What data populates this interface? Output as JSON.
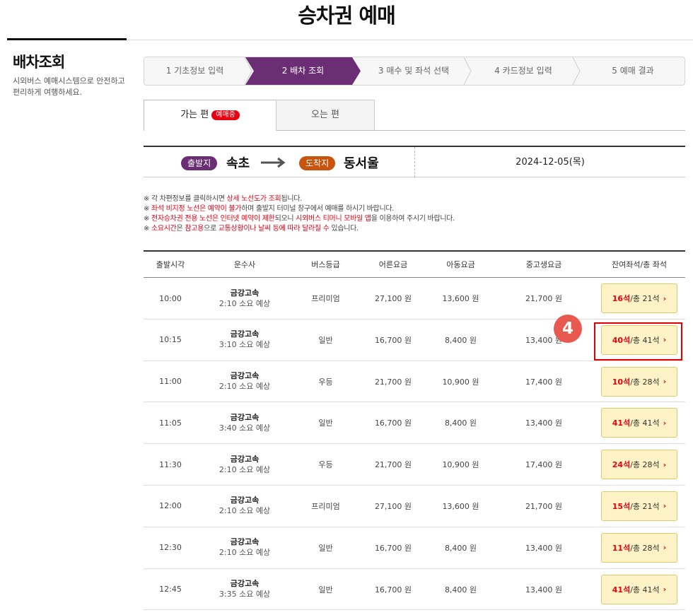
{
  "page": {
    "title": "승차권 예매"
  },
  "sidebar": {
    "title": "배차조회",
    "description": "시외버스 예매시스템으로 안전하고 편리하게 여행하세요."
  },
  "stepper": {
    "steps": [
      {
        "label": "1 기초정보 입력",
        "active": false
      },
      {
        "label": "2 배차 조회",
        "active": true
      },
      {
        "label": "3 매수 및 좌석 선택",
        "active": false
      },
      {
        "label": "4 카드정보 입력",
        "active": false
      },
      {
        "label": "5 예매 결과",
        "active": false
      }
    ],
    "active_color": "#6b2d73"
  },
  "tabs": {
    "go_label": "가는 편",
    "go_badge": "예매중",
    "return_label": "오는 편"
  },
  "route": {
    "departure_label": "출발지",
    "departure": "속초",
    "arrival_label": "도착지",
    "arrival": "동서울",
    "date": "2024-12-05(목)"
  },
  "notices": [
    [
      "※ 각 차편정보를 클릭하시면 ",
      {
        "red": "상세 노선도가 조회"
      },
      "됩니다."
    ],
    [
      "※ ",
      {
        "red": "좌석 비지정 노선은 예약이 불가"
      },
      "하며 출발지 터미널 창구에서 예매를 하시기 바랍니다."
    ],
    [
      "※ ",
      {
        "red": "전자승차권 전용 노선은 인터넷 예약이 제한"
      },
      "되오니 ",
      {
        "red": "시외버스 티머니 모바일 앱"
      },
      "을 이용하여 주시기 바랍니다."
    ],
    [
      "※ ",
      {
        "red": "소요시간"
      },
      "은 ",
      {
        "red": "참고용"
      },
      "으로 ",
      {
        "red": "교통상황이나 날씨 등에 따라 달라질 수"
      },
      " 있습니다."
    ]
  ],
  "table": {
    "headers": [
      "출발시각",
      "운수사",
      "버스등급",
      "어른요금",
      "아동요금",
      "중고생요금",
      "잔여좌석/총 좌석"
    ],
    "rows": [
      {
        "time": "10:00",
        "company": "금강고속",
        "duration": "2:10 소요 예상",
        "grade": "프리미엄",
        "adult": "27,100 원",
        "child": "13,600 원",
        "youth": "21,700 원",
        "remaining": "16석",
        "total": " /총 21석"
      },
      {
        "time": "10:15",
        "company": "금강고속",
        "duration": "3:10 소요 예상",
        "grade": "일반",
        "adult": "16,700 원",
        "child": "8,400 원",
        "youth": "13,400 원",
        "remaining": "40석",
        "total": " /총 41석"
      },
      {
        "time": "11:00",
        "company": "금강고속",
        "duration": "2:10 소요 예상",
        "grade": "우등",
        "adult": "21,700 원",
        "child": "10,900 원",
        "youth": "17,400 원",
        "remaining": "10석",
        "total": " /총 28석"
      },
      {
        "time": "11:05",
        "company": "금강고속",
        "duration": "3:40 소요 예상",
        "grade": "일반",
        "adult": "16,700 원",
        "child": "8,400 원",
        "youth": "13,400 원",
        "remaining": "41석",
        "total": " /총 41석"
      },
      {
        "time": "11:30",
        "company": "금강고속",
        "duration": "2:10 소요 예상",
        "grade": "우등",
        "adult": "21,700 원",
        "child": "10,900 원",
        "youth": "17,400 원",
        "remaining": "24석",
        "total": " /총 28석"
      },
      {
        "time": "12:00",
        "company": "금강고속",
        "duration": "2:10 소요 예상",
        "grade": "프리미엄",
        "adult": "27,100 원",
        "child": "13,600 원",
        "youth": "21,700 원",
        "remaining": "15석",
        "total": " /총 21석"
      },
      {
        "time": "12:30",
        "company": "금강고속",
        "duration": "2:10 소요 예상",
        "grade": "일반",
        "adult": "16,700 원",
        "child": "8,400 원",
        "youth": "13,400 원",
        "remaining": "11석",
        "total": " /총 28석"
      },
      {
        "time": "12:45",
        "company": "금강고속",
        "duration": "3:35 소요 예상",
        "grade": "일반",
        "adult": "16,700 원",
        "child": "8,400 원",
        "youth": "13,400 원",
        "remaining": "41석",
        "total": " /총 41석"
      }
    ]
  },
  "annotation": {
    "step_number": "4",
    "highlighted_row": 1,
    "color": "#e00000"
  }
}
